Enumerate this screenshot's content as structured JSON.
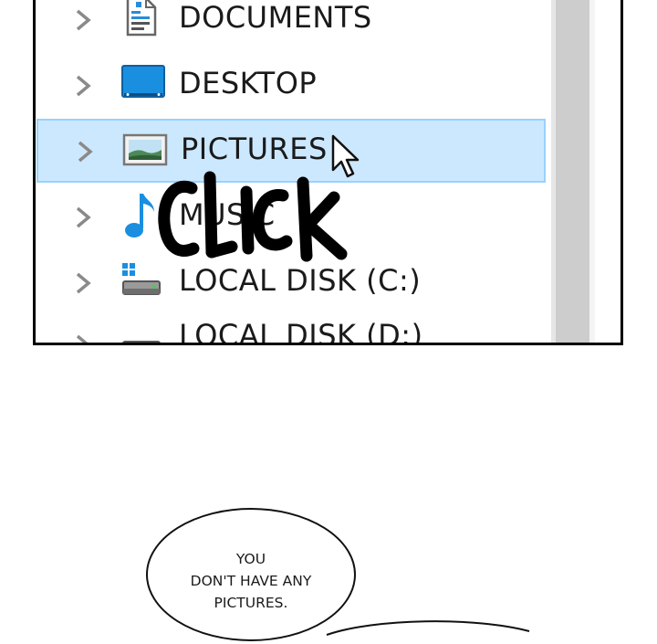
{
  "explorer": {
    "items": [
      {
        "label": "DOCUMENTS",
        "icon": "document-icon",
        "selected": false
      },
      {
        "label": "DESKTOP",
        "icon": "desktop-icon",
        "selected": false
      },
      {
        "label": "PICTURES",
        "icon": "pictures-icon",
        "selected": true
      },
      {
        "label": "MUSIC",
        "icon": "music-note-icon",
        "selected": false
      },
      {
        "label": "LOCAL DISK (C:)",
        "icon": "local-disk-c-icon",
        "selected": false
      },
      {
        "label": "LOCAL DISK (D:)",
        "icon": "local-disk-d-icon",
        "selected": false
      }
    ],
    "colors": {
      "selection_fill": "#cce8ff",
      "selection_border": "#99d1ff",
      "accent": "#1a8fe0"
    }
  },
  "sound_effect": "CLICK",
  "speech_bubble": {
    "lines": [
      "YOU",
      "DON'T HAVE ANY",
      "PICTURES."
    ]
  }
}
